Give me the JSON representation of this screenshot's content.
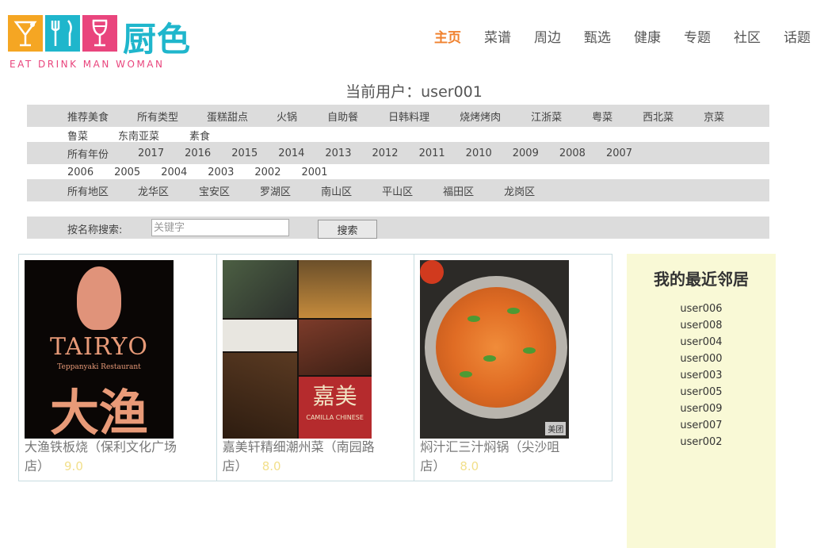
{
  "header": {
    "brand": "厨色",
    "tagline": "EAT DRINK MAN WOMAN",
    "logo_icons": [
      "cocktail-icon",
      "fork-knife-icon",
      "wine-glass-icon"
    ],
    "nav": [
      {
        "label": "主页",
        "active": true
      },
      {
        "label": "菜谱"
      },
      {
        "label": "周边"
      },
      {
        "label": "甄选"
      },
      {
        "label": "健康"
      },
      {
        "label": "专题"
      },
      {
        "label": "社区"
      },
      {
        "label": "话题"
      }
    ]
  },
  "current_user": "当前用户：user001",
  "filters": {
    "categories": [
      "推荐美食",
      "所有类型",
      "蛋糕甜点",
      "火锅",
      "自助餐",
      "日韩料理",
      "烧烤烤肉",
      "江浙菜",
      "粤菜",
      "西北菜",
      "京菜",
      "鲁菜",
      "东南亚菜",
      "素食"
    ],
    "years": [
      "所有年份",
      "2017",
      "2016",
      "2015",
      "2014",
      "2013",
      "2012",
      "2011",
      "2010",
      "2009",
      "2008",
      "2007",
      "2006",
      "2005",
      "2004",
      "2003",
      "2002",
      "2001"
    ],
    "areas": [
      "所有地区",
      "龙华区",
      "宝安区",
      "罗湖区",
      "南山区",
      "平山区",
      "福田区",
      "龙岗区"
    ]
  },
  "search": {
    "label": "按名称搜索:",
    "placeholder": "关键字",
    "value": "",
    "button": "搜索"
  },
  "restaurants": [
    {
      "name": "大渔铁板烧（保利文化广场店）",
      "score": "9.0",
      "image_text": [
        "TAIRYO",
        "Teppanyaki Restaurant",
        "大渔"
      ]
    },
    {
      "name": "嘉美轩精细潮州菜（南园路店）",
      "score": "8.0",
      "image_text": [
        "嘉美",
        "CAMILLA CHINESE"
      ]
    },
    {
      "name": "焖汁汇三汁焖锅（尖沙咀店）",
      "score": "8.0",
      "image_text": [
        "美团"
      ]
    }
  ],
  "neighbors": {
    "title": "我的最近邻居",
    "users": [
      "user006",
      "user008",
      "user004",
      "user000",
      "user003",
      "user005",
      "user009",
      "user007",
      "user002"
    ]
  },
  "colors": {
    "nav_active": "#f0822f",
    "filter_bg": "#dcdcdc",
    "sidebar_bg": "#f9f9d6",
    "score": "#f2df8a",
    "brand": "#1fb6cc",
    "tagline": "#e9457d"
  }
}
